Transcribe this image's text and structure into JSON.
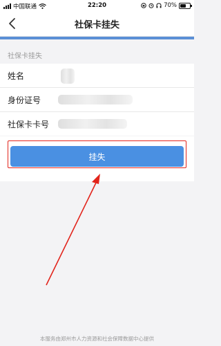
{
  "status_bar": {
    "carrier": "中国联通",
    "time": "22:20",
    "battery_level": "70%",
    "battery_fraction": 0.7
  },
  "nav": {
    "title": "社保卡挂失"
  },
  "section_title": "社保卡挂失",
  "form": {
    "rows": [
      {
        "label": "姓名"
      },
      {
        "label": "身份证号"
      },
      {
        "label": "社保卡卡号"
      }
    ]
  },
  "action": {
    "button_label": "挂失"
  },
  "footer": {
    "text": "本服务由郑州市人力资源和社会保障数据中心提供"
  },
  "colors": {
    "accent": "#4a90e2",
    "annotation_red": "#e2241b"
  },
  "icons": [
    "back-icon",
    "wifi-icon",
    "battery-icon",
    "alarm-icon",
    "headphones-icon",
    "lock-icon"
  ]
}
